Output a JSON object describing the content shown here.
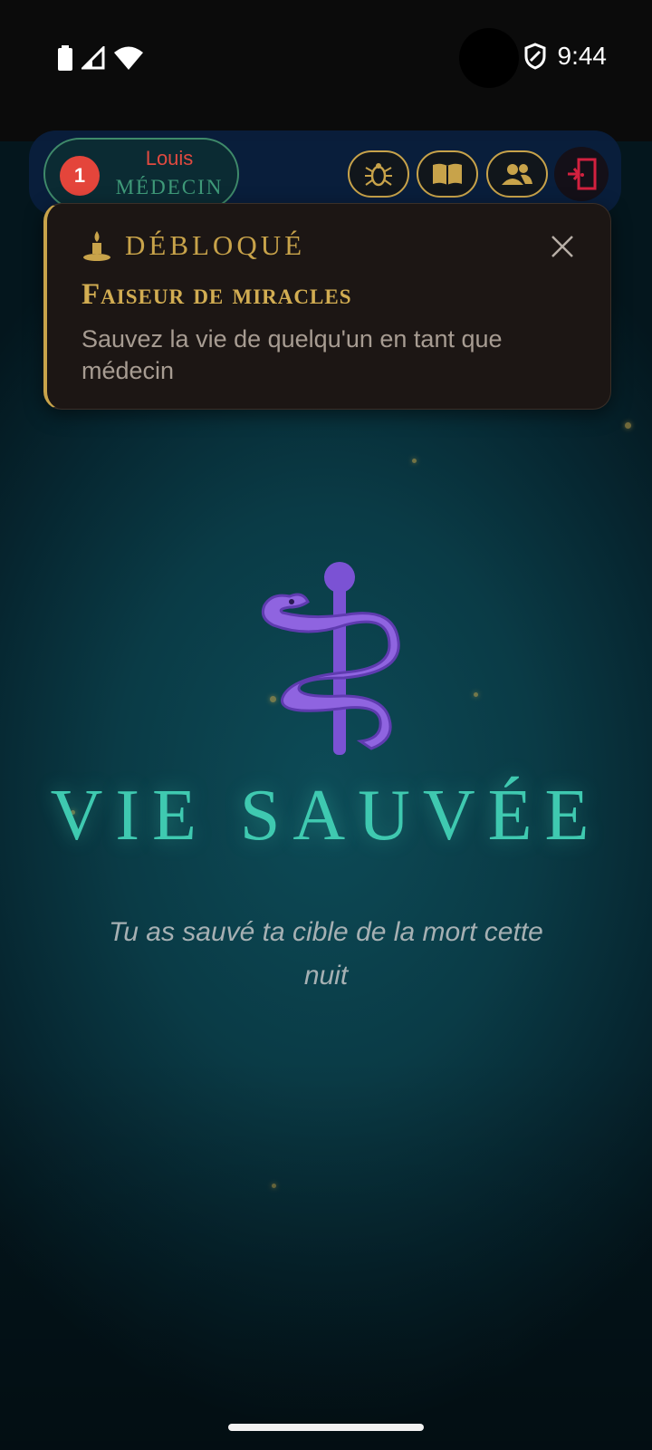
{
  "status_bar": {
    "time": "9:44",
    "icons": [
      "battery-icon",
      "signal-icon",
      "wifi-icon",
      "shield-icon"
    ]
  },
  "player": {
    "number": "1",
    "name": "Louis",
    "role": "MÉDECIN"
  },
  "toolbar": {
    "buttons": [
      "bug-icon",
      "book-icon",
      "players-icon",
      "exit-door-icon"
    ]
  },
  "notification": {
    "kicker": "DÉBLOQUÉ",
    "title": "Faiseur de miracles",
    "description": "Sauvez la vie de quelqu'un en tant que médecin",
    "icon": "candle-icon"
  },
  "result": {
    "icon": "caduceus-icon",
    "title": "VIE SAUVÉE",
    "subtitle": "Tu as sauvé ta cible de la mort cette nuit"
  },
  "colors": {
    "accent_gold": "#c8a34a",
    "teal": "#3fc9b0",
    "player_red": "#e14a40",
    "role_green": "#3f9a79",
    "caduceus_purple": "#7b4fcf"
  }
}
